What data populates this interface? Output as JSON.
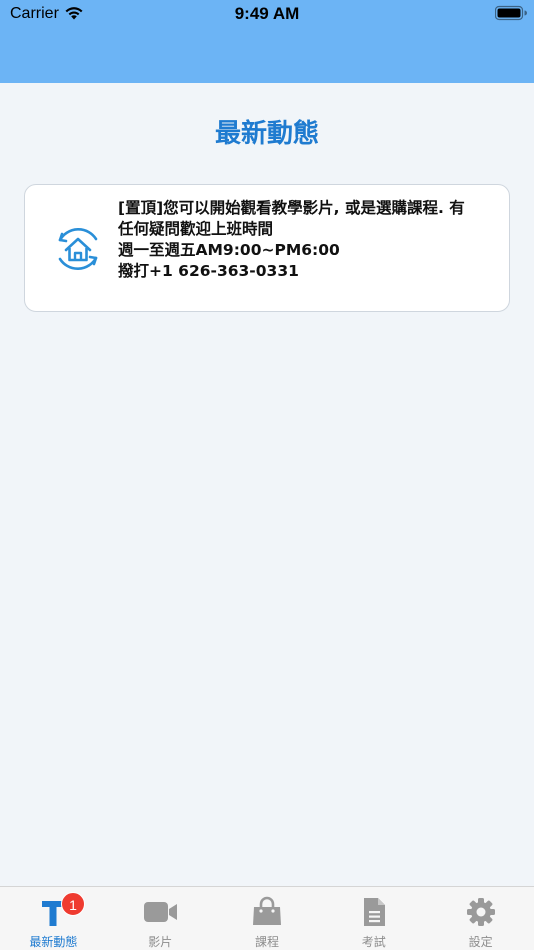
{
  "status_bar": {
    "carrier": "Carrier",
    "time": "9:49 AM"
  },
  "header": {
    "background": "#6cb4f5"
  },
  "page": {
    "title": "最新動態",
    "title_color": "#1f7bd0"
  },
  "posts": [
    {
      "icon": "home-refresh-icon",
      "lines": [
        "[置頂]您可以開始觀看教學影片, 或是選購課程. 有",
        "任何疑問歡迎上班時間",
        "週一至週五AM9:00~PM6:00",
        "撥打+1 626-363-0331"
      ]
    }
  ],
  "tabbar": {
    "tabs": [
      {
        "label": "最新動態",
        "icon": "news-t-icon",
        "active": true,
        "badge": "1"
      },
      {
        "label": "影片",
        "icon": "video-camera-icon",
        "active": false
      },
      {
        "label": "課程",
        "icon": "shopping-bag-icon",
        "active": false
      },
      {
        "label": "考試",
        "icon": "document-icon",
        "active": false
      },
      {
        "label": "設定",
        "icon": "gear-icon",
        "active": false
      }
    ],
    "active_color": "#1f7bd0",
    "inactive_color": "#8d8d8d"
  }
}
